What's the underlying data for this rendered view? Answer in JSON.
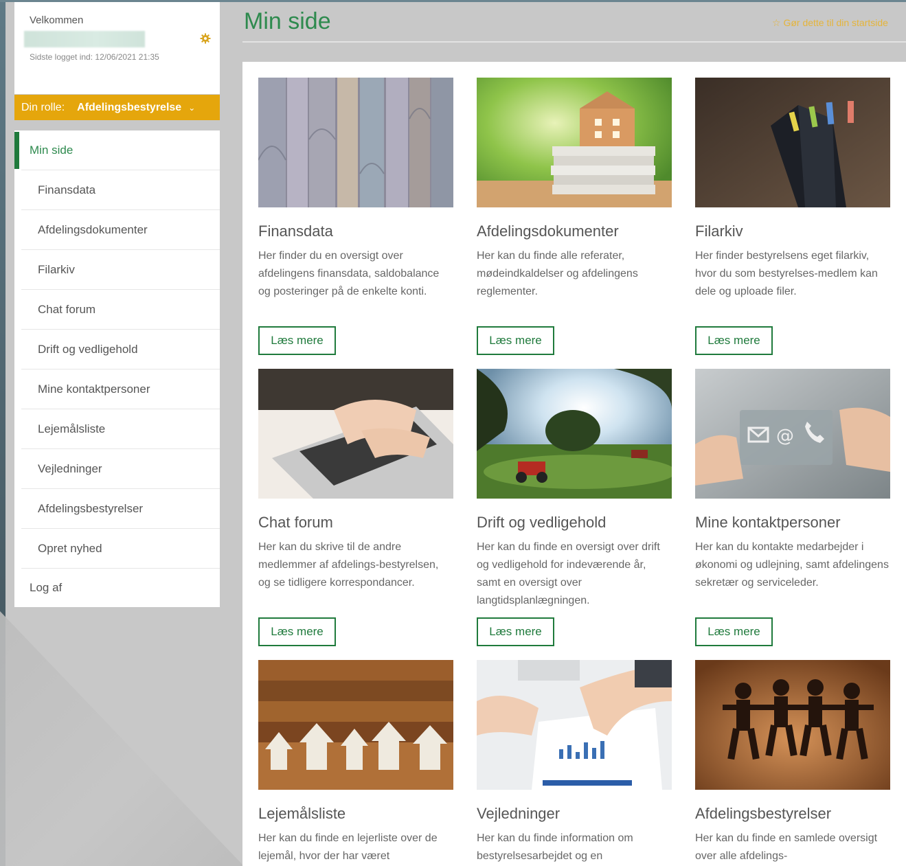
{
  "user": {
    "welcome": "Velkommen",
    "last_login": "Sidste logget ind: 12/06/2021 21:35"
  },
  "role": {
    "label": "Din rolle:",
    "value": "Afdelingsbestyrelse"
  },
  "nav": {
    "items": [
      {
        "label": "Min side"
      },
      {
        "label": "Finansdata"
      },
      {
        "label": "Afdelingsdokumenter"
      },
      {
        "label": "Filarkiv"
      },
      {
        "label": "Chat forum"
      },
      {
        "label": "Drift og vedligehold"
      },
      {
        "label": "Mine kontaktpersoner"
      },
      {
        "label": "Lejemålsliste"
      },
      {
        "label": "Vejledninger"
      },
      {
        "label": "Afdelingsbestyrelser"
      },
      {
        "label": "Opret nyhed"
      },
      {
        "label": "Log af"
      }
    ]
  },
  "header": {
    "title": "Min side",
    "start_link": "Gør dette til din startside"
  },
  "cards": [
    {
      "title": "Finansdata",
      "text": "Her finder du en oversigt over afdelingens finansdata, saldobalance og posteringer på de enkelte konti.",
      "button": "Læs mere"
    },
    {
      "title": "Afdelingsdokumenter",
      "text": "Her kan du finde alle referater, mødeindkaldelser og afdelingens reglementer.",
      "button": "Læs mere"
    },
    {
      "title": "Filarkiv",
      "text": "Her finder bestyrelsens eget filarkiv, hvor du som bestyrelses-medlem kan dele og uploade filer.",
      "button": "Læs mere"
    },
    {
      "title": "Chat forum",
      "text": "Her kan du skrive til de andre medlemmer af afdelings-bestyrelsen, og se tidligere korrespondancer.",
      "button": "Læs mere"
    },
    {
      "title": "Drift og vedligehold",
      "text": "Her kan du finde en oversigt over drift og vedligehold for indeværende år, samt en oversigt over langtidsplanlægningen.",
      "button": "Læs mere"
    },
    {
      "title": "Mine kontaktpersoner",
      "text": "Her kan du kontakte medarbejder i økonomi og udlejning, samt afdelingens sekretær og serviceleder.",
      "button": "Læs mere"
    },
    {
      "title": "Lejemålsliste",
      "text": "Her kan du finde en lejerliste over de lejemål, hvor der har været"
    },
    {
      "title": "Vejledninger",
      "text": "Her kan du finde information om bestyrelsesarbejdet og en"
    },
    {
      "title": "Afdelingsbestyrelser",
      "text": "Her kan du finde en samlede oversigt over alle afdelings-"
    }
  ],
  "colors": {
    "brand_green": "#1f7a3c",
    "role_orange": "#e5a60c",
    "accent_gold": "#e5b43a"
  }
}
